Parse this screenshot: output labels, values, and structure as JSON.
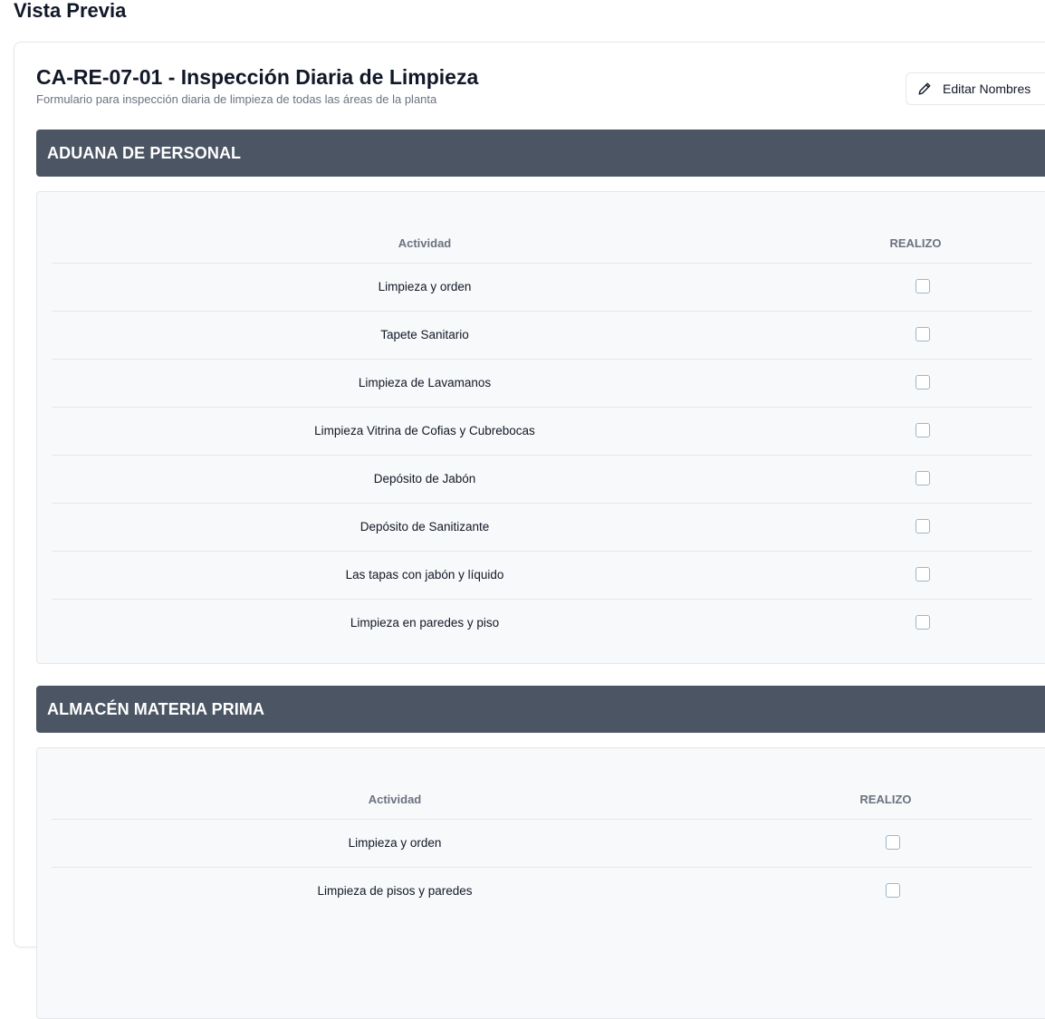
{
  "page": {
    "title": "Vista Previa"
  },
  "form": {
    "title": "CA-RE-07-01 - Inspección Diaria de Limpieza",
    "subtitle": "Formulario para inspección diaria de limpieza de todas las áreas de la planta",
    "edit_button": {
      "label": "Editar Nombres",
      "icon": "pencil-icon"
    }
  },
  "sections": [
    {
      "title": "ADUANA DE PERSONAL",
      "columns": {
        "activity": "Actividad",
        "done": "REALIZO"
      },
      "rows": [
        {
          "activity": "Limpieza y orden",
          "done": false
        },
        {
          "activity": "Tapete Sanitario",
          "done": false
        },
        {
          "activity": "Limpieza de Lavamanos",
          "done": false
        },
        {
          "activity": "Limpieza Vitrina de Cofias y Cubrebocas",
          "done": false
        },
        {
          "activity": "Depósito de Jabón",
          "done": false
        },
        {
          "activity": "Depósito de Sanitizante",
          "done": false
        },
        {
          "activity": "Las tapas con jabón y líquido",
          "done": false
        },
        {
          "activity": "Limpieza en paredes y piso",
          "done": false
        }
      ]
    },
    {
      "title": "ALMACÉN MATERIA PRIMA",
      "columns": {
        "activity": "Actividad",
        "done": "REALIZO"
      },
      "rows": [
        {
          "activity": "Limpieza y orden",
          "done": false
        },
        {
          "activity": "Limpieza de pisos y paredes",
          "done": false
        }
      ]
    }
  ],
  "colors": {
    "section_header_bg": "#4b5563",
    "section_body_bg": "#f8f9fa",
    "checkbox_border": "#9cb6cc"
  }
}
